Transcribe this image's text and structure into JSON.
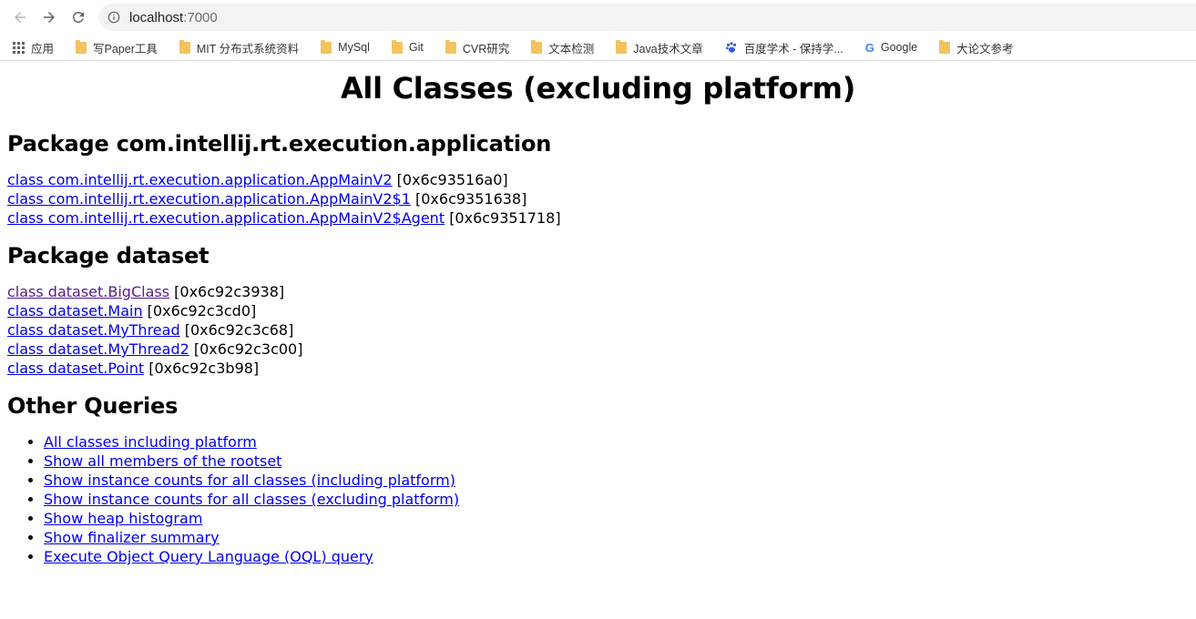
{
  "browser": {
    "url_host": "localhost",
    "url_port": ":7000",
    "bookmarks": [
      {
        "icon": "apps-icon",
        "label": "应用"
      },
      {
        "icon": "folder-icon",
        "label": "写Paper工具"
      },
      {
        "icon": "folder-icon",
        "label": "MIT 分布式系统资料"
      },
      {
        "icon": "folder-icon",
        "label": "MySql"
      },
      {
        "icon": "folder-icon",
        "label": "Git"
      },
      {
        "icon": "folder-icon",
        "label": "CVR研究"
      },
      {
        "icon": "folder-icon",
        "label": "文本检测"
      },
      {
        "icon": "folder-icon",
        "label": "Java技术文章"
      },
      {
        "icon": "baidu-paw-icon",
        "label": "百度学术 - 保持学..."
      },
      {
        "icon": "google-icon",
        "label": "Google"
      },
      {
        "icon": "folder-icon",
        "label": "大论文参考"
      }
    ]
  },
  "page": {
    "title": "All Classes (excluding platform)",
    "packages": [
      {
        "heading": "Package com.intellij.rt.execution.application",
        "classes": [
          {
            "name": "class com.intellij.rt.execution.application.AppMainV2",
            "addr": "[0x6c93516a0]"
          },
          {
            "name": "class com.intellij.rt.execution.application.AppMainV2$1",
            "addr": "[0x6c9351638]"
          },
          {
            "name": "class com.intellij.rt.execution.application.AppMainV2$Agent",
            "addr": "[0x6c9351718]"
          }
        ]
      },
      {
        "heading": "Package dataset",
        "classes": [
          {
            "name": "class dataset.BigClass",
            "addr": "[0x6c92c3938]"
          },
          {
            "name": "class dataset.Main",
            "addr": "[0x6c92c3cd0]"
          },
          {
            "name": "class dataset.MyThread",
            "addr": "[0x6c92c3c68]"
          },
          {
            "name": "class dataset.MyThread2",
            "addr": "[0x6c92c3c00]"
          },
          {
            "name": "class dataset.Point",
            "addr": "[0x6c92c3b98]"
          }
        ]
      }
    ],
    "other_heading": "Other Queries",
    "queries": [
      "All classes including platform",
      "Show all members of the rootset",
      "Show instance counts for all classes (including platform)",
      "Show instance counts for all classes (excluding platform)",
      "Show heap histogram",
      "Show finalizer summary",
      "Execute Object Query Language (OQL) query"
    ]
  },
  "colors": {
    "link": "#0000ee",
    "visited_link": "#551a8b",
    "folder": "#f3c35f"
  }
}
